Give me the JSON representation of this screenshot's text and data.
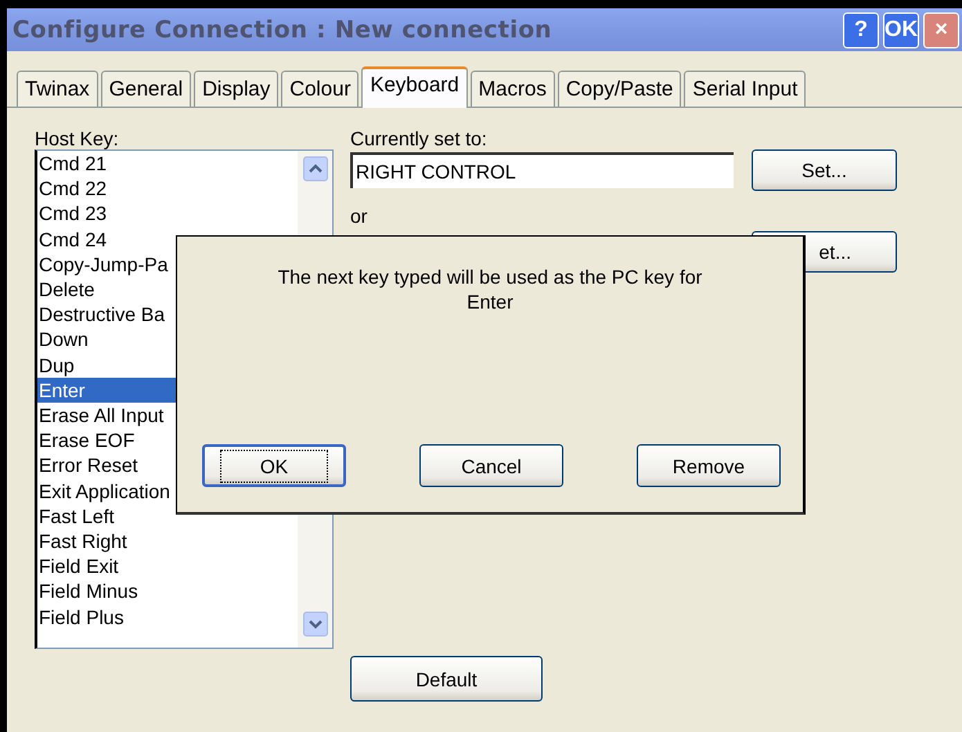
{
  "window": {
    "title": "Configure Connection : New connection",
    "buttons": [
      {
        "kind": "help",
        "label": "?"
      },
      {
        "kind": "ok",
        "label": "OK"
      },
      {
        "kind": "close",
        "label": "×"
      }
    ]
  },
  "tabs": [
    {
      "label": "Twinax",
      "selected": false
    },
    {
      "label": "General",
      "selected": false
    },
    {
      "label": "Display",
      "selected": false
    },
    {
      "label": "Colour",
      "selected": false
    },
    {
      "label": "Keyboard",
      "selected": true
    },
    {
      "label": "Macros",
      "selected": false
    },
    {
      "label": "Copy/Paste",
      "selected": false
    },
    {
      "label": "Serial Input",
      "selected": false
    }
  ],
  "host_key": {
    "label": "Host Key:",
    "items": [
      {
        "label": "Cmd 21",
        "selected": false
      },
      {
        "label": "Cmd 22",
        "selected": false
      },
      {
        "label": "Cmd 23",
        "selected": false
      },
      {
        "label": "Cmd 24",
        "selected": false
      },
      {
        "label": "Copy-Jump-Pa",
        "selected": false
      },
      {
        "label": "Delete",
        "selected": false
      },
      {
        "label": "Destructive Ba",
        "selected": false
      },
      {
        "label": "Down",
        "selected": false
      },
      {
        "label": "Dup",
        "selected": false
      },
      {
        "label": "Enter",
        "selected": true
      },
      {
        "label": "Erase All Input",
        "selected": false
      },
      {
        "label": "Erase EOF",
        "selected": false
      },
      {
        "label": "Error Reset",
        "selected": false
      },
      {
        "label": "Exit Application",
        "selected": false
      },
      {
        "label": "Fast Left",
        "selected": false
      },
      {
        "label": "Fast Right",
        "selected": false
      },
      {
        "label": "Field Exit",
        "selected": false
      },
      {
        "label": "Field Minus",
        "selected": false
      },
      {
        "label": "Field Plus",
        "selected": false
      }
    ]
  },
  "current": {
    "label": "Currently set to:",
    "value": "RIGHT CONTROL",
    "set_button": "Set...",
    "or": "or",
    "second_set_button": "et..."
  },
  "default_button": "Default",
  "dialog": {
    "message": "The next key typed will be used as the PC key for Enter",
    "buttons": [
      {
        "label": "OK",
        "selected": true
      },
      {
        "label": "Cancel",
        "selected": false
      },
      {
        "label": "Remove",
        "selected": false
      }
    ]
  }
}
